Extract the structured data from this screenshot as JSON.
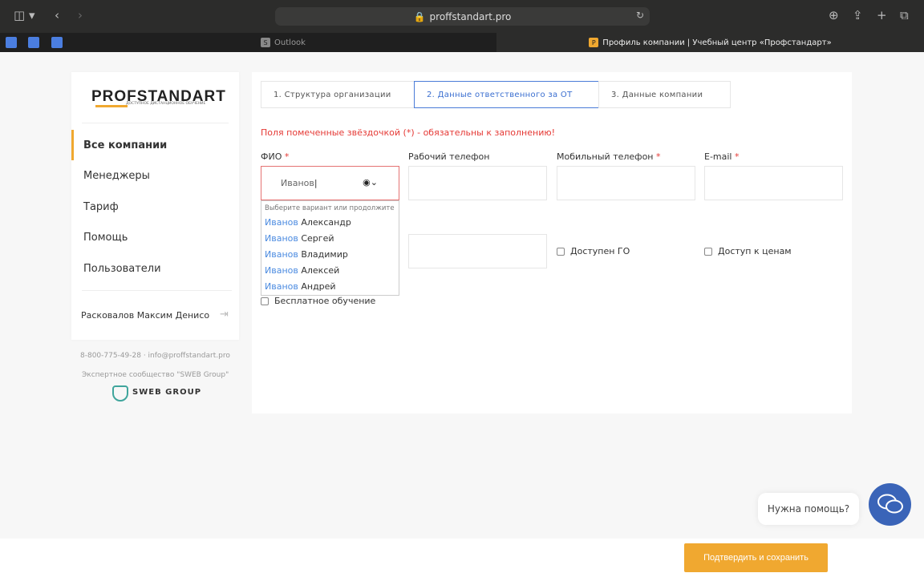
{
  "browser": {
    "url": "proffstandart.pro",
    "tabs": [
      {
        "label": "Outlook",
        "favicon": "S"
      },
      {
        "label": "Профиль компании | Учебный центр «Профстандарт»",
        "favicon": "P"
      }
    ]
  },
  "sidebar": {
    "logo": "PROFSTANDART",
    "logo_sub": "доступное дистанционное обучение",
    "items": [
      {
        "label": "Все компании"
      },
      {
        "label": "Менеджеры"
      },
      {
        "label": "Тариф"
      },
      {
        "label": "Помощь"
      },
      {
        "label": "Пользователи"
      }
    ],
    "user": "Расковалов Максим Денисович",
    "contacts": "8-800-775-49-28 · info@proffstandart.pro",
    "community": "Экспертное сообщество \"SWEB Group\"",
    "sweb_logo": "SWEB GROUP"
  },
  "steps": [
    {
      "label": "1. Структура организации"
    },
    {
      "label": "2. Данные ответственного за ОТ"
    },
    {
      "label": "3. Данные компании"
    }
  ],
  "form": {
    "notice": "Поля помеченные звёздочкой (*) - обязательны к заполнению!",
    "fio_label": "ФИО",
    "fio_value": "Иванов",
    "work_phone_label": "Рабочий телефон",
    "mobile_label": "Мобильный телефон",
    "email_label": "E-mail",
    "required_mark": "*",
    "dropdown_hint": "Выберите вариант или продолжите",
    "suggestions": [
      {
        "match": "Иванов",
        "rest": " Александр"
      },
      {
        "match": "Иванов",
        "rest": " Сергей"
      },
      {
        "match": "Иванов",
        "rest": " Владимир"
      },
      {
        "match": "Иванов",
        "rest": " Алексей"
      },
      {
        "match": "Иванов",
        "rest": " Андрей"
      }
    ],
    "go_access": "Доступен ГО",
    "price_access": "Доступ к ценам",
    "free_training": "Бесплатное обучение"
  },
  "help": {
    "bubble": "Нужна помощь?"
  },
  "footer": {
    "save_label": "Подтвердить и сохранить"
  },
  "colors": {
    "accent": "#f0a830",
    "link": "#4a7bd8",
    "error": "#e53935",
    "chat": "#3a64b8"
  }
}
